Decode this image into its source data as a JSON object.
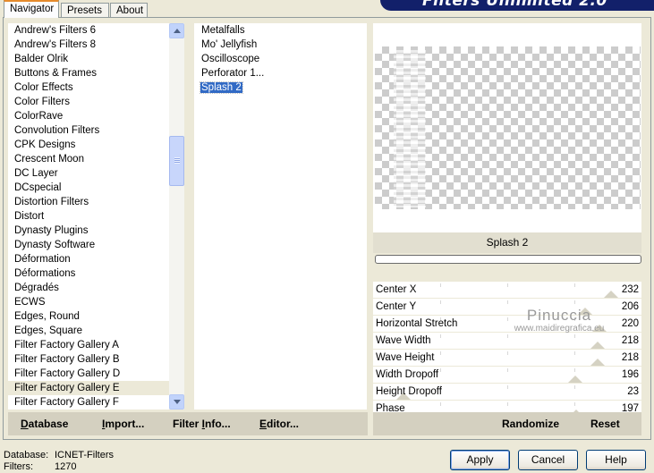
{
  "tabs": [
    "Navigator",
    "Presets",
    "About"
  ],
  "banner_title": "Filters Unlimited 2.0",
  "categories": [
    "Andrew's Filters 6",
    "Andrew's Filters 8",
    "Balder Olrik",
    "Buttons & Frames",
    "Color Effects",
    "Color Filters",
    "ColorRave",
    "Convolution Filters",
    "CPK Designs",
    "Crescent Moon",
    "DC Layer",
    "DCspecial",
    "Distortion Filters",
    "Distort",
    "Dynasty Plugins",
    "Dynasty Software",
    "Déformation",
    "Déformations",
    "Dégradés",
    "ECWS",
    "Edges, Round",
    "Edges, Square",
    "Filter Factory Gallery A",
    "Filter Factory Gallery B",
    "Filter Factory Gallery D",
    "Filter Factory Gallery E",
    "Filter Factory Gallery F"
  ],
  "selected_category": "Filter Factory Gallery E",
  "filters": [
    "Metalfalls",
    "Mo' Jellyfish",
    "Oscilloscope",
    "Perforator 1...",
    "Splash 2"
  ],
  "selected_filter": "Splash 2",
  "preview_filter_name": "Splash 2",
  "params": [
    {
      "label": "Center X",
      "value": "232",
      "level": 232
    },
    {
      "label": "Center Y",
      "value": "206",
      "level": 206
    },
    {
      "label": "Horizontal Stretch",
      "value": "220",
      "level": 220
    },
    {
      "label": "Wave Width",
      "value": "218",
      "level": 218
    },
    {
      "label": "Wave Height",
      "value": "218",
      "level": 218
    },
    {
      "label": "Width Dropoff",
      "value": "196",
      "level": 196
    },
    {
      "label": "Height Dropoff",
      "value": "23",
      "level": 23
    },
    {
      "label": "Phase",
      "value": "197",
      "level": 197
    }
  ],
  "param_max": 255,
  "watermark": {
    "line1": "Pinuccia",
    "line2": "www.maidiregrafica.eu"
  },
  "left_actions": {
    "database_u": "D",
    "database_rest": "atabase",
    "import_u": "I",
    "import_rest": "mport...",
    "filterinfo_a": "Filter ",
    "filterinfo_u": "I",
    "filterinfo_b": "nfo...",
    "editor_u": "E",
    "editor_rest": "ditor..."
  },
  "right_actions": {
    "randomize": "Randomize",
    "reset": "Reset"
  },
  "status": {
    "database_key": "Database:",
    "database_val": "ICNET-Filters",
    "filters_key": "Filters:",
    "filters_val": "1270"
  },
  "buttons": {
    "apply": "Apply",
    "cancel": "Cancel",
    "help": "Help"
  },
  "colors": {
    "selection": "#316ac5",
    "dialog_bg": "#ece9d8",
    "banner": "#12206a"
  }
}
